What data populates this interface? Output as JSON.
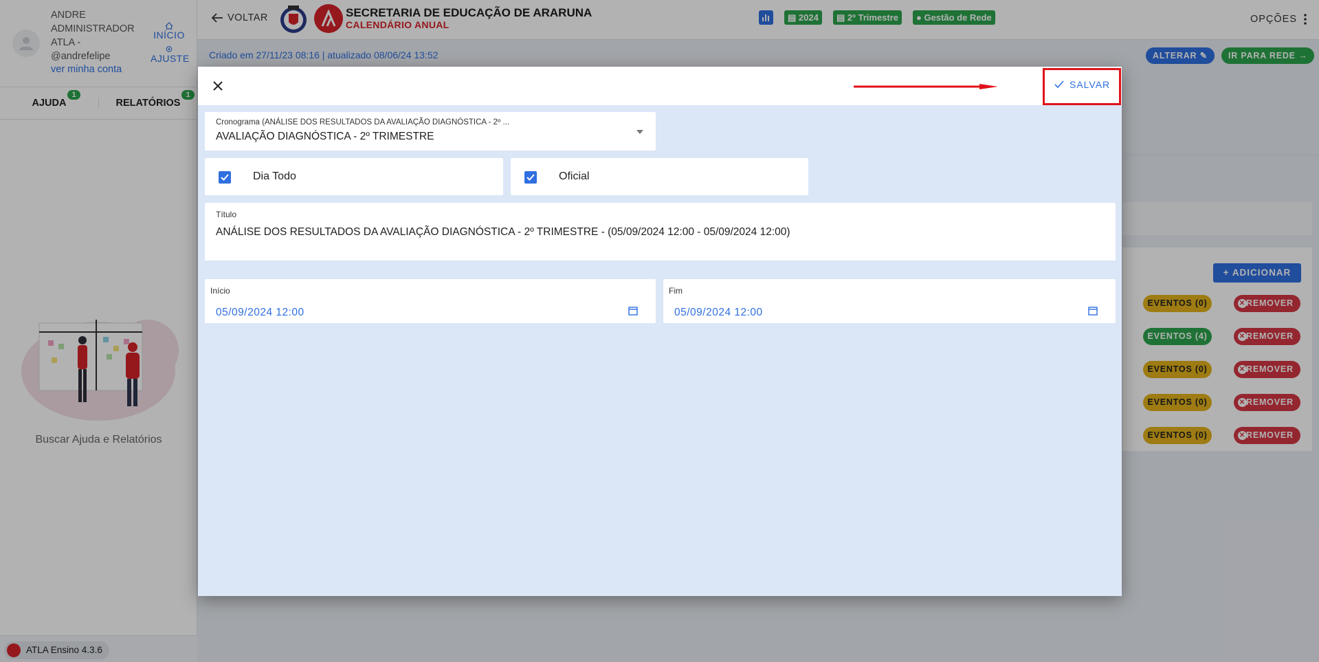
{
  "sidebar": {
    "user_name_lines": [
      "ANDRE",
      "ADMINISTRADOR",
      "ATLA -",
      "@andrefelipe"
    ],
    "account_link": "ver minha conta",
    "inicio": "INÍCIO",
    "ajuste": "AJUSTE",
    "tabs": [
      {
        "label": "AJUDA",
        "badge": "1"
      },
      {
        "label": "RELATÓRIOS",
        "badge": "1"
      }
    ],
    "caption": "Buscar Ajuda e Relatórios",
    "version": "ATLA Ensino 4.3.6"
  },
  "header": {
    "back": "VOLTAR",
    "title": "SECRETARIA DE EDUCAÇÃO DE ARARUNA",
    "subtitle": "CALENDÁRIO ANUAL",
    "chips": {
      "year": "2024",
      "term": "2º Trimestre",
      "scope": "Gestão de Rede"
    },
    "options": "OPÇÕES"
  },
  "page": {
    "created": "Criado em 27/11/23 08:16 | atualizado 08/06/24 13:52",
    "alterar": "ALTERAR",
    "ir_rede": "IR PARA REDE",
    "adicionar": "ADICIONAR",
    "rows": [
      {
        "eventos": "EVENTOS (0)",
        "remover": "REMOVER",
        "status": "yellow"
      },
      {
        "eventos": "EVENTOS (4)",
        "remover": "REMOVER",
        "status": "green"
      },
      {
        "eventos": "EVENTOS (0)",
        "remover": "REMOVER",
        "status": "yellow"
      },
      {
        "eventos": "EVENTOS (0)",
        "remover": "REMOVER",
        "status": "yellow"
      },
      {
        "eventos": "EVENTOS (0)",
        "remover": "REMOVER",
        "status": "yellow"
      }
    ]
  },
  "modal": {
    "save": "SALVAR",
    "cronograma_label": "Cronograma (ANÁLISE DOS RESULTADOS DA AVALIAÇÃO DIAGNÓSTICA - 2º ...",
    "cronograma_value": "AVALIAÇÃO DIAGNÓSTICA - 2º TRIMESTRE",
    "dia_todo": "Dia Todo",
    "oficial": "Oficial",
    "titulo_label": "Título",
    "titulo_value": "ANÁLISE DOS RESULTADOS DA AVALIAÇÃO DIAGNÓSTICA - 2º TRIMESTRE - (05/09/2024 12:00 - 05/09/2024 12:00)",
    "inicio_label": "Início",
    "inicio_value": "05/09/2024 12:00",
    "fim_label": "Fim",
    "fim_value": "05/09/2024 12:00"
  },
  "colors": {
    "primary": "#2f6fe0",
    "success": "#2ca44c",
    "warning": "#e3b21c",
    "danger": "#d53744",
    "highlight": "#e0121a"
  }
}
